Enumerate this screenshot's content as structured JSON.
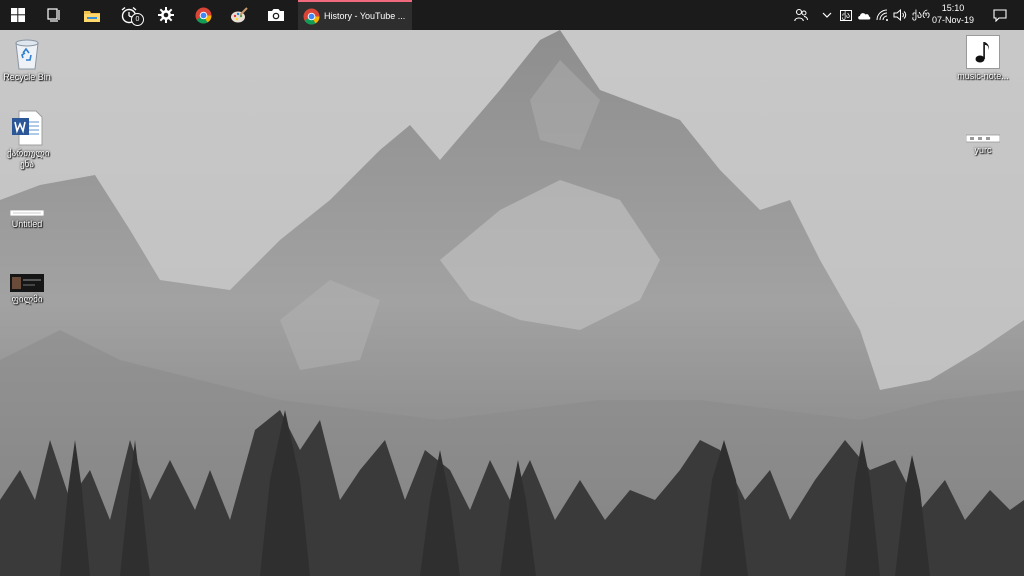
{
  "taskbar": {
    "start_icon": "windows-start-icon",
    "taskview_icon": "task-view-icon",
    "pinned": [
      {
        "name": "file-explorer-icon"
      },
      {
        "name": "alarms-icon",
        "badge": "0"
      },
      {
        "name": "settings-icon"
      },
      {
        "name": "chrome-icon"
      },
      {
        "name": "paint-icon"
      },
      {
        "name": "camera-icon"
      }
    ],
    "active_app": {
      "icon": "chrome-icon",
      "label": "History - YouTube ..."
    },
    "tray": {
      "people_icon": "people-icon",
      "chevron_icon": "chevron-up-icon",
      "language_badge": "ქა",
      "onedrive_icon": "cloud-icon",
      "network_icon": "wifi-icon",
      "volume_icon": "volume-icon",
      "input_language": "ქარ",
      "time": "15:10",
      "date": "07-Nov-19",
      "notification_icon": "action-center-icon"
    },
    "accent_color": "#f06a7d"
  },
  "desktop": {
    "icons_left": [
      {
        "label": "Recycle Bin",
        "icon": "recycle-bin-icon"
      },
      {
        "label": "ქართული ენა",
        "icon": "word-document-icon"
      },
      {
        "label": "Untitled",
        "icon": "image-file-icon"
      },
      {
        "label": "ფილმი",
        "icon": "video-file-icon"
      }
    ],
    "icons_right": [
      {
        "label": "music-note...",
        "icon": "music-note-icon"
      },
      {
        "label": "yurc",
        "icon": "image-file-icon"
      }
    ]
  }
}
